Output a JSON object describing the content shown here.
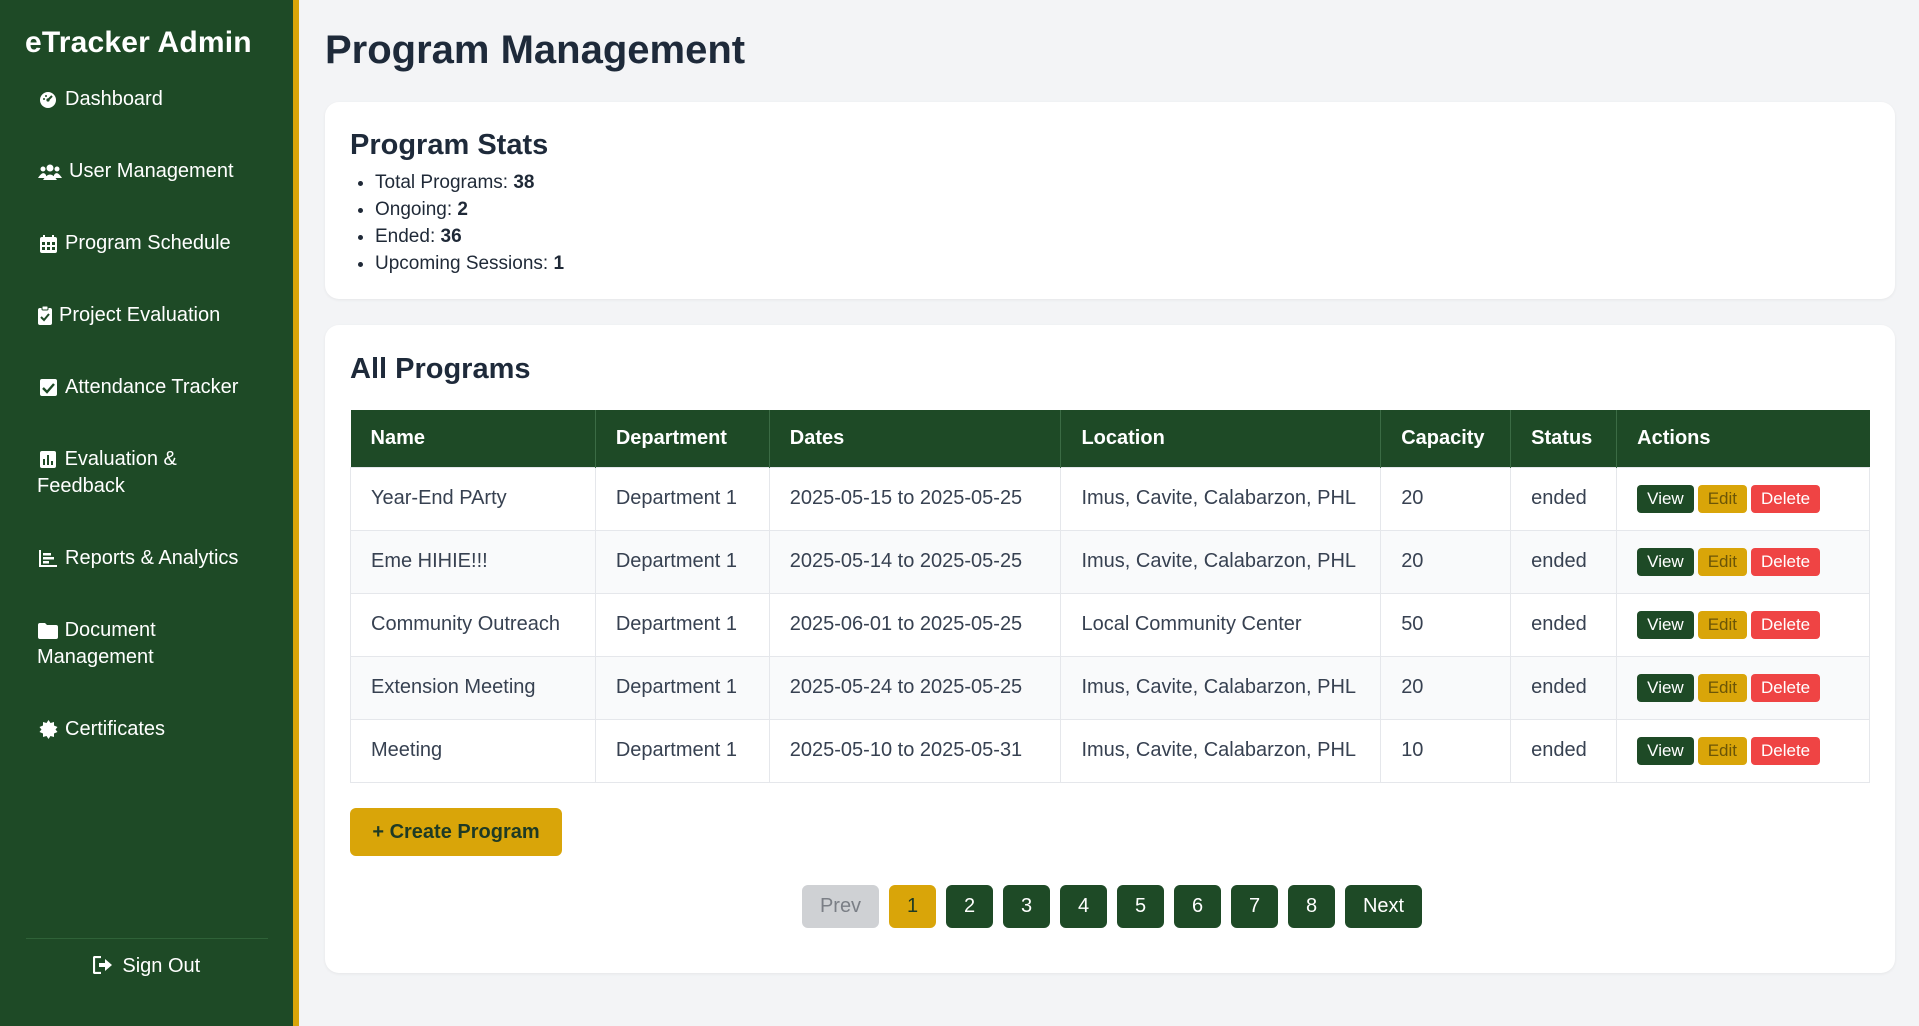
{
  "sidebar": {
    "brand": "eTracker Admin",
    "items": [
      {
        "label": "Dashboard",
        "icon": "dashboard-icon"
      },
      {
        "label": "User Management",
        "icon": "users-icon"
      },
      {
        "label": "Program Schedule",
        "icon": "calendar-icon"
      },
      {
        "label": "Project Evaluation",
        "icon": "clipboard-icon"
      },
      {
        "label": "Attendance Tracker",
        "icon": "checkbox-icon"
      },
      {
        "label": "Evaluation & Feedback",
        "icon": "chart-icon"
      },
      {
        "label": "Reports & Analytics",
        "icon": "report-icon"
      },
      {
        "label": "Document Management",
        "icon": "folder-icon"
      },
      {
        "label": "Certificates",
        "icon": "certificate-icon"
      }
    ],
    "sign_out": "Sign Out"
  },
  "page": {
    "title": "Program Management"
  },
  "stats": {
    "title": "Program Stats",
    "items": [
      {
        "label": "Total Programs:",
        "value": "38"
      },
      {
        "label": "Ongoing:",
        "value": "2"
      },
      {
        "label": "Ended:",
        "value": "36"
      },
      {
        "label": "Upcoming Sessions:",
        "value": "1"
      }
    ]
  },
  "programs": {
    "title": "All Programs",
    "columns": [
      "Name",
      "Department",
      "Dates",
      "Location",
      "Capacity",
      "Status",
      "Actions"
    ],
    "rows": [
      {
        "name": "Year-End PArty",
        "department": "Department 1",
        "dates": "2025-05-15 to 2025-05-25",
        "location": "Imus, Cavite, Calabarzon, PHL",
        "capacity": "20",
        "status": "ended"
      },
      {
        "name": "Eme HIHIE!!!",
        "department": "Department 1",
        "dates": "2025-05-14 to 2025-05-25",
        "location": "Imus, Cavite, Calabarzon, PHL",
        "capacity": "20",
        "status": "ended"
      },
      {
        "name": "Community Outreach",
        "department": "Department 1",
        "dates": "2025-06-01 to 2025-05-25",
        "location": "Local Community Center",
        "capacity": "50",
        "status": "ended"
      },
      {
        "name": "Extension Meeting",
        "department": "Department 1",
        "dates": "2025-05-24 to 2025-05-25",
        "location": "Imus, Cavite, Calabarzon, PHL",
        "capacity": "20",
        "status": "ended"
      },
      {
        "name": "Meeting",
        "department": "Department 1",
        "dates": "2025-05-10 to 2025-05-31",
        "location": "Imus, Cavite, Calabarzon, PHL",
        "capacity": "10",
        "status": "ended"
      }
    ],
    "actions": {
      "view": "View",
      "edit": "Edit",
      "delete": "Delete"
    },
    "create_label": "+ Create Program"
  },
  "pagination": {
    "prev": "Prev",
    "next": "Next",
    "pages": [
      "1",
      "2",
      "3",
      "4",
      "5",
      "6",
      "7",
      "8"
    ],
    "current": "1"
  },
  "colors": {
    "sidebar_bg": "#1e4a26",
    "accent": "#d9a509",
    "danger": "#ef4444",
    "page_bg": "#f3f4f6"
  }
}
